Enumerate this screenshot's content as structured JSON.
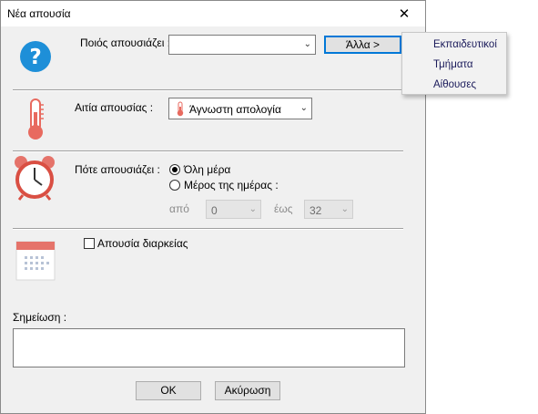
{
  "window": {
    "title": "Νέα απουσία"
  },
  "who": {
    "label": "Ποιός απουσιάζει :",
    "value": "",
    "other_button": "Άλλα >"
  },
  "reason": {
    "label": "Αιτία απουσίας :",
    "value": "Άγνωστη απολογία"
  },
  "when": {
    "label": "Πότε απουσιάζει :",
    "full_day": "Όλη μέρα",
    "part_day": "Μέρος της ημέρας :",
    "from_label": "από",
    "from_value": "0",
    "to_label": "έως",
    "to_value": "32"
  },
  "duration": {
    "label": "Απουσία διαρκείας",
    "checked": false
  },
  "notes": {
    "label": "Σημείωση :",
    "value": ""
  },
  "buttons": {
    "ok": "OK",
    "cancel": "Ακύρωση"
  },
  "popup_menu": {
    "items": [
      "Εκπαιδευτικοί",
      "Τμήματα",
      "Αίθουσες"
    ]
  },
  "colors": {
    "accent": "#0078d7",
    "help_icon": "#1e8fd8",
    "thermometer": "#e86a5f",
    "clock": "#d94f43",
    "calendar": "#e5736a"
  }
}
